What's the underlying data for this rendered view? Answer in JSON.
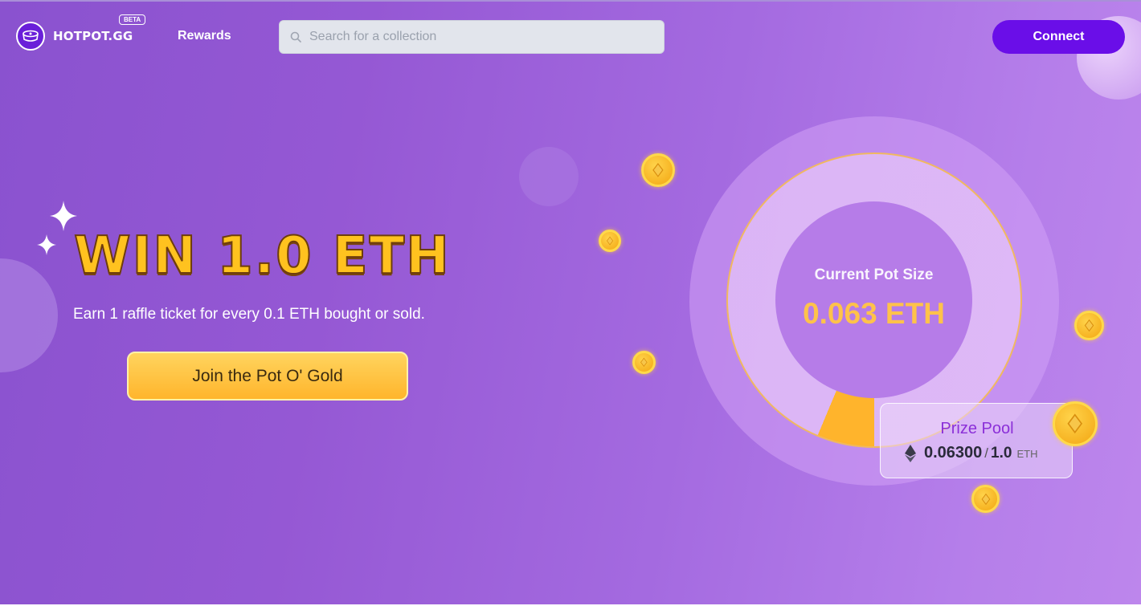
{
  "header": {
    "logo_text": "HOTPOT.GG",
    "beta_label": "BETA",
    "nav": {
      "rewards_label": "Rewards"
    },
    "search": {
      "placeholder": "Search for a collection",
      "value": ""
    },
    "connect_label": "Connect"
  },
  "hero": {
    "headline": "WIN 1.0 ETH",
    "subline": "Earn 1 raffle ticket for every 0.1 ETH bought or sold.",
    "cta_label": "Join the Pot O' Gold"
  },
  "pot": {
    "label": "Current Pot Size",
    "value_text": "0.063 ETH",
    "fill_fraction": 0.063
  },
  "prize_pool": {
    "title": "Prize Pool",
    "amount": "0.06300",
    "separator": "/",
    "total": "1.0",
    "unit": "ETH"
  },
  "colors": {
    "accent": "#6a0ee8",
    "gold": "#ffc21f",
    "pot_fill": "#ffb42c",
    "prize_title": "#8b2fd8"
  },
  "icons": [
    "hotpot-logo-icon",
    "search-icon",
    "sparkle-icon",
    "coin-icon",
    "ethereum-icon"
  ]
}
